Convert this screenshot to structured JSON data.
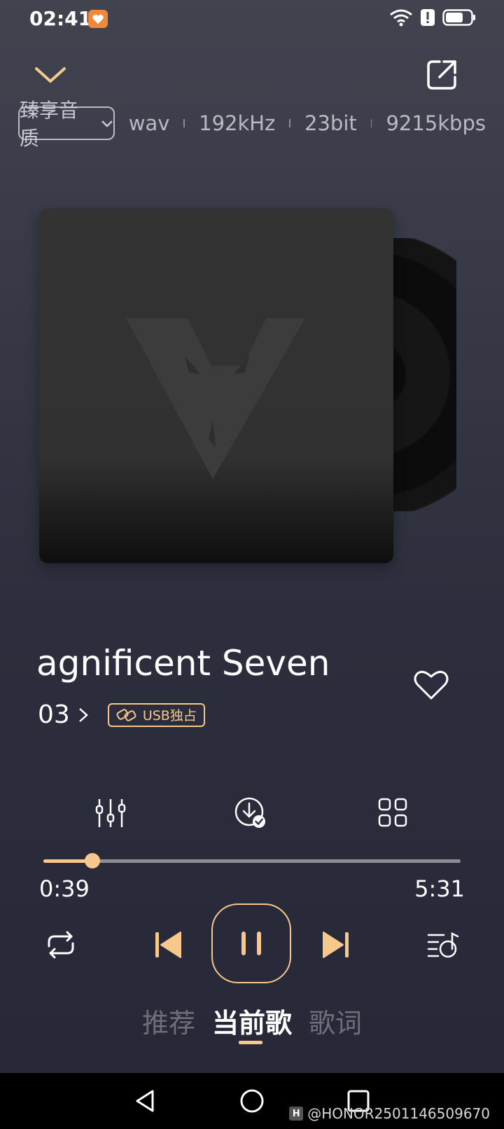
{
  "status_bar": {
    "time": "02:41",
    "icons": [
      "app-badge-icon",
      "wifi-icon",
      "alert-icon",
      "battery-icon"
    ]
  },
  "header": {
    "collapse_icon": "chevron-down-icon",
    "share_icon": "share-external-icon"
  },
  "quality": {
    "mode_label": "臻享音质",
    "format": "wav",
    "sample_rate": "192kHz",
    "bit_depth": "23bit",
    "bitrate": "9215kbps"
  },
  "song": {
    "title": "agnificent Seven",
    "artist": "03",
    "badge_label": "USB独占"
  },
  "tools": [
    "equalizer-icon",
    "downloaded-icon",
    "more-grid-icon"
  ],
  "progress": {
    "current": "0:39",
    "total": "5:31",
    "fraction": 0.118
  },
  "controls": [
    "repeat-icon",
    "previous-icon",
    "pause-icon",
    "next-icon",
    "queue-icon"
  ],
  "tabs": [
    {
      "label": "推荐",
      "active": false
    },
    {
      "label": "当前歌",
      "active": true
    },
    {
      "label": "歌词",
      "active": false
    }
  ],
  "watermark": "@HONOR2501146509670",
  "colors": {
    "accent": "#f6c88b",
    "background_top": "#41434f",
    "background_bottom": "#262838"
  }
}
